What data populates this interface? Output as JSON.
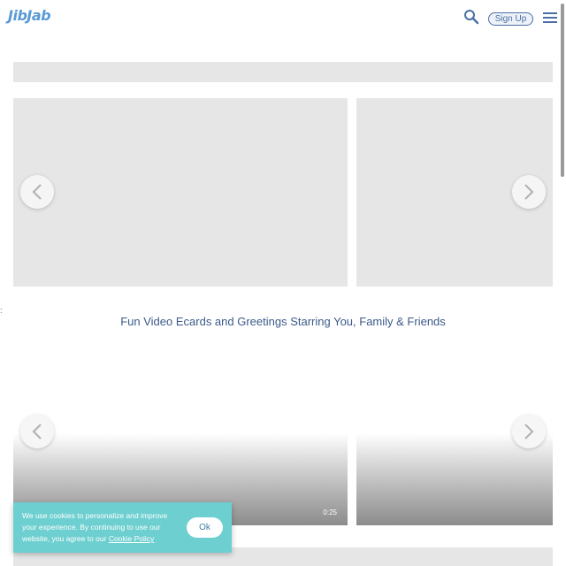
{
  "header": {
    "logo_text": "JibJab",
    "signup_label": "Sign Up",
    "icons": [
      "search-icon",
      "hamburger-menu-icon"
    ]
  },
  "hero_carousel": {
    "prev_icon": "chevron-left-icon",
    "next_icon": "chevron-right-icon"
  },
  "left_mark": ":",
  "tagline": "Fun Video Ecards and Greetings Starring You, Family & Friends",
  "video_carousel": {
    "cards": [
      {
        "duration": "0:25"
      },
      {
        "duration": ""
      }
    ],
    "prev_icon": "chevron-left-icon",
    "next_icon": "chevron-right-icon"
  },
  "cookie_banner": {
    "text": "We use cookies to personalize and improve your experience. By continuing to use our website, you agree to our ",
    "link_label": "Cookie Policy",
    "ok_label": "Ok",
    "background_color": "#6ecfd0"
  },
  "colors": {
    "brand": "#5b9bd5",
    "accent": "#4a6fa5",
    "tagline": "#3c5a8a",
    "placeholder": "#e6e6e6"
  }
}
